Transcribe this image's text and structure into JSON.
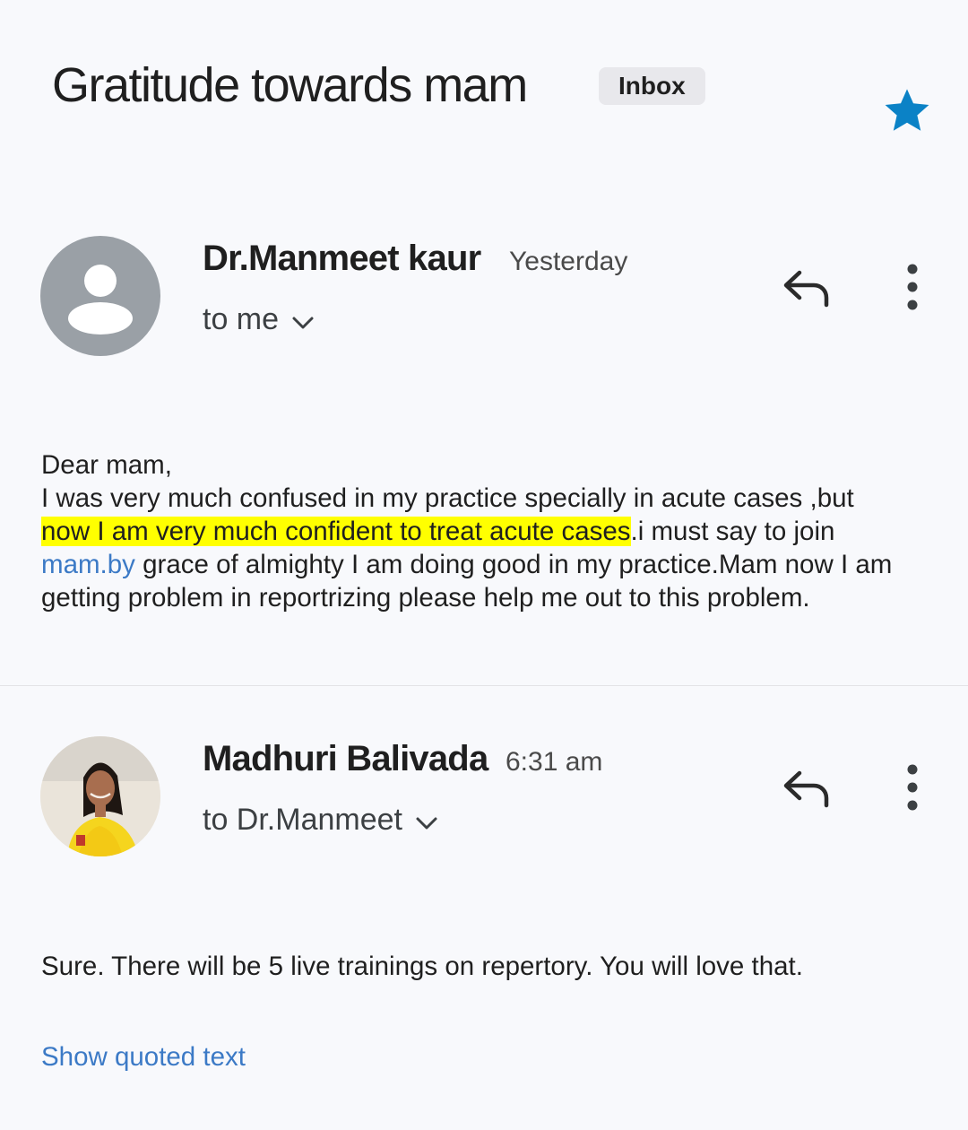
{
  "thread": {
    "subject": "Gratitude towards mam",
    "label": "Inbox",
    "starred": true,
    "star_color": "#0b82c6"
  },
  "messages": [
    {
      "sender": "Dr.Manmeet kaur",
      "time": "Yesterday",
      "recipient": "to me",
      "avatar": "person-placeholder-icon",
      "body": {
        "greeting": "Dear mam,",
        "line_before_highlight": "I was very much confused in my practice specially in acute cases ,but",
        "highlight": "now I am very much confident to treat acute cases",
        "after_highlight": ".i must say to join",
        "link_text": "mam.by",
        "after_link": " grace of almighty I am doing good in my practice.Mam now I am getting problem in reportrizing please help me out to this problem."
      }
    },
    {
      "sender": "Madhuri Balivada",
      "time": "6:31 am",
      "recipient": "to Dr.Manmeet",
      "avatar": "profile-photo",
      "body": {
        "text": "Sure. There will be 5 live trainings on repertory. You will love that."
      },
      "show_quoted": "Show quoted text"
    }
  ],
  "colors": {
    "background": "#f8f9fc",
    "highlight": "#ffff00",
    "link": "#3c7ac6",
    "generic_avatar": "#9aa0a6"
  }
}
